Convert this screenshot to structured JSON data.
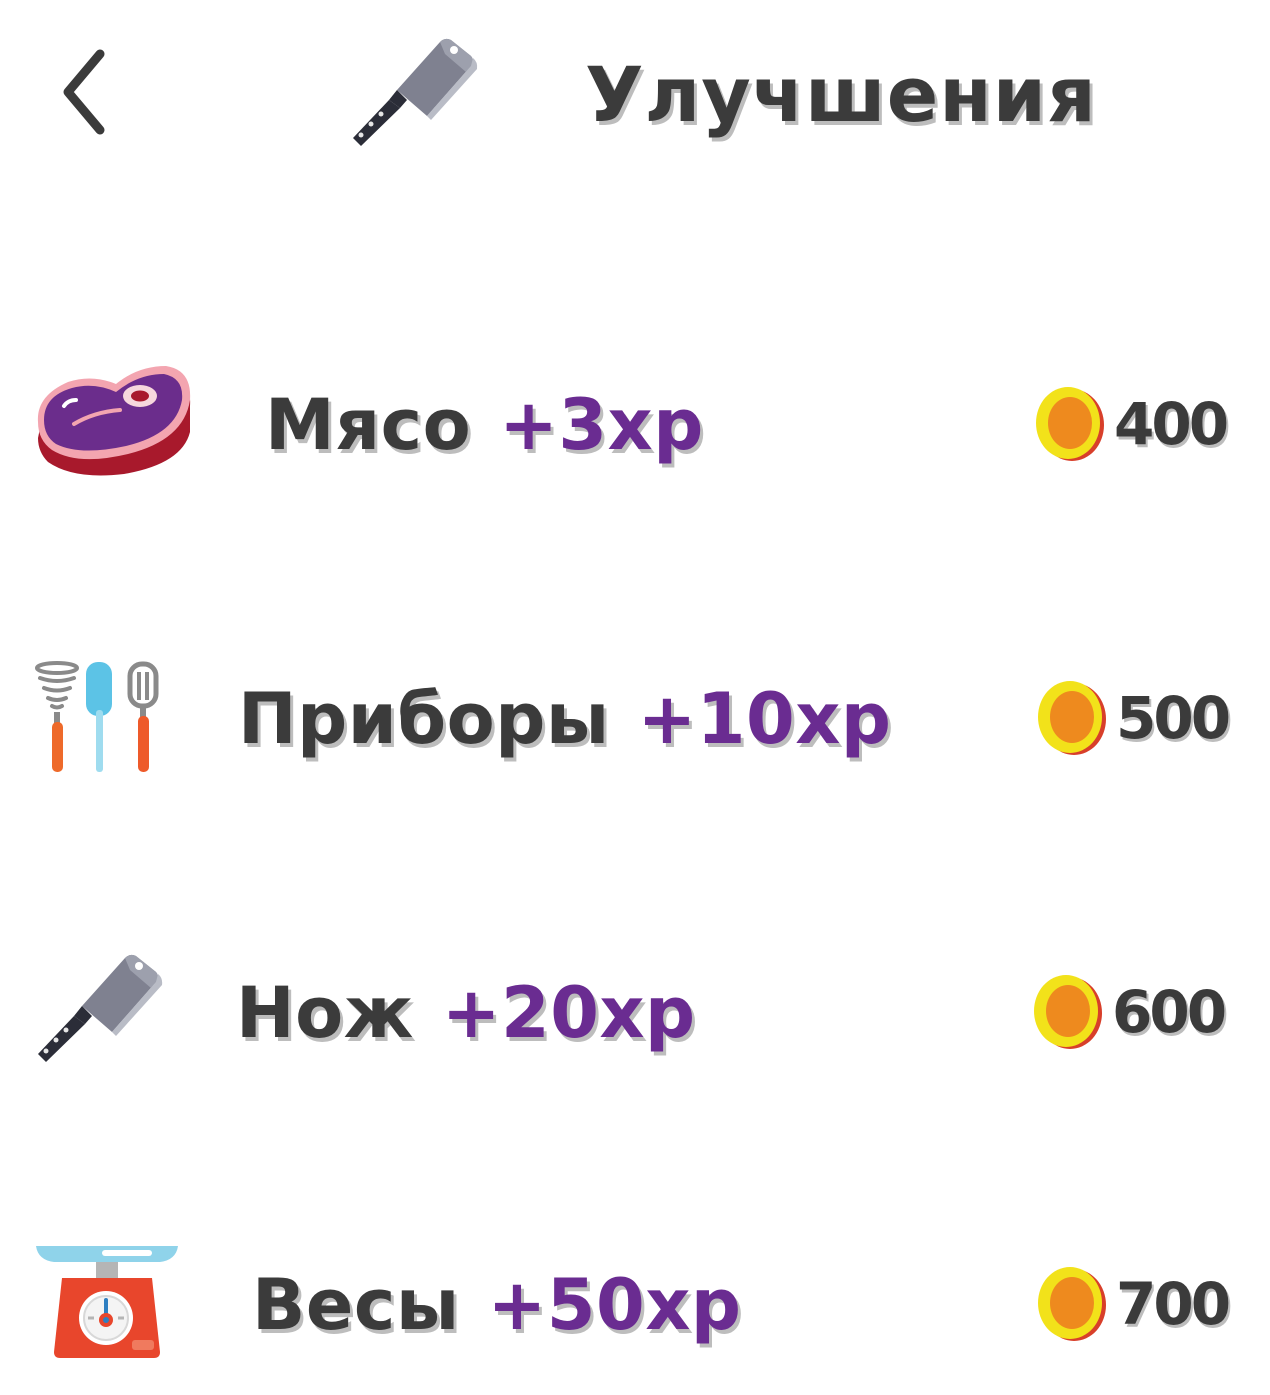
{
  "header": {
    "title": "Улучшения",
    "back_icon": "chevron-left-icon",
    "title_icon": "cleaver-icon"
  },
  "upgrades": [
    {
      "name": "Мясо",
      "bonus": "+3xp",
      "price": "400",
      "icon": "steak-icon"
    },
    {
      "name": "Приборы",
      "bonus": "+10xp",
      "price": "500",
      "icon": "utensils-icon"
    },
    {
      "name": "Нож",
      "bonus": "+20xp",
      "price": "600",
      "icon": "cleaver-icon"
    },
    {
      "name": "Весы",
      "bonus": "+50xp",
      "price": "700",
      "icon": "kitchen-scale-icon"
    }
  ],
  "colors": {
    "text": "#3b3b3b",
    "bonus": "#6a2c91",
    "coin_outer": "#f2e21a",
    "coin_inner": "#ee8a1e"
  }
}
